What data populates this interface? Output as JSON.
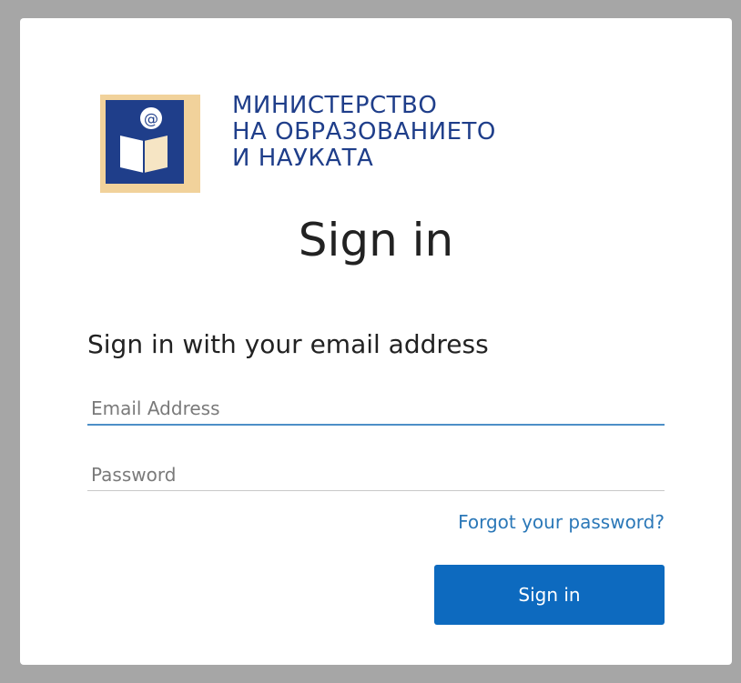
{
  "logo": {
    "line1": "МИНИСТЕРСТВО",
    "line2": "НА ОБРАЗОВАНИЕТО",
    "line3": "И НАУКАТА",
    "icon": "book-at-sign-icon",
    "colors": {
      "navy": "#1f3e8a",
      "tan": "#f1d29b"
    }
  },
  "page": {
    "title": "Sign in",
    "subtitle": "Sign in with your email address"
  },
  "form": {
    "email_placeholder": "Email Address",
    "password_placeholder": "Password",
    "forgot_link": "Forgot your password?",
    "submit_label": "Sign in"
  },
  "colors": {
    "accent": "#0d6abf",
    "link": "#2b78b8",
    "background": "#a6a6a6"
  }
}
